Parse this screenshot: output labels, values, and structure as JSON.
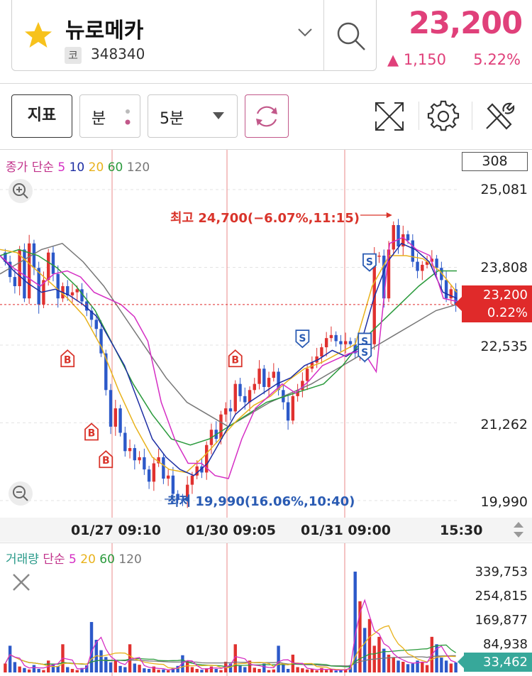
{
  "header": {
    "stock_name": "뉴로메카",
    "code_badge": "코",
    "stock_code": "348340",
    "price": "23,200",
    "change": "▲ 1,150",
    "change_rate": "5.22%"
  },
  "toolbar": {
    "indicator_label": "지표",
    "unit_label": "분",
    "interval_label": "5분"
  },
  "chart_data": {
    "type": "candlestick",
    "legend": {
      "price_type": "종가",
      "ma_type": "단순",
      "ma_periods": [
        "5",
        "10",
        "20",
        "60",
        "120"
      ]
    },
    "ma_colors": [
      "#d52ec4",
      "#1d2ea3",
      "#e8b21c",
      "#2a9a3c",
      "#777777"
    ],
    "y_ticks": [
      "25,081",
      "23,808",
      "22,535",
      "21,262",
      "19,990"
    ],
    "ylim": [
      19990,
      25081
    ],
    "top_badge": "308",
    "current_price": "23,200",
    "current_rate": "0.22%",
    "x_ticks": [
      "01/27 09:10",
      "01/30 09:05",
      "01/31 09:00",
      "15:30"
    ],
    "high_annotation": "최고 24,700(−6.07%,11:15)",
    "low_annotation": "최저 19,990(16.06%,10:40)",
    "signal_labels": {
      "buy": "B",
      "sell": "S"
    },
    "close": [
      23900,
      23650,
      23500,
      24100,
      23300,
      24200,
      23800,
      23200,
      23600,
      24050,
      23700,
      23300,
      23500,
      23350,
      23400,
      23450,
      23250,
      23100,
      22950,
      22800,
      22400,
      21800,
      21200,
      21500,
      21100,
      20800,
      20850,
      20650,
      20700,
      20500,
      20300,
      20600,
      20700,
      20350,
      20400,
      20100,
      20000,
      19990,
      20250,
      20400,
      20550,
      20450,
      20900,
      21150,
      21000,
      21400,
      21500,
      21450,
      21900,
      21700,
      21600,
      21800,
      21900,
      22150,
      21850,
      22000,
      22100,
      21800,
      21600,
      21300,
      21700,
      21800,
      21950,
      22150,
      22250,
      22350,
      22500,
      22650,
      22700,
      22600,
      22550,
      22600,
      22550,
      22400,
      22500,
      22400,
      22550,
      24000,
      24000,
      23300,
      24100,
      24500,
      24150,
      24350,
      24250,
      23900,
      23750,
      23850,
      23900,
      23950,
      23800,
      23600,
      23300,
      23450,
      23200
    ],
    "buy_signals": [
      {
        "x": 13,
        "price": 22300
      },
      {
        "x": 18,
        "price": 21100
      },
      {
        "x": 21,
        "price": 20650
      },
      {
        "x": 48,
        "price": 22300
      }
    ],
    "sell_signals": [
      {
        "x": 62,
        "price": 22650
      },
      {
        "x": 75,
        "price": 22600
      },
      {
        "x": 75,
        "price": 22420
      },
      {
        "x": 76,
        "price": 23900
      }
    ],
    "ma": {
      "5": [
        24000,
        23800,
        23650,
        23500,
        23700,
        23750,
        23650,
        23400,
        23300,
        23200,
        23000,
        22600,
        21600,
        21000,
        20600,
        20600,
        20400,
        20350,
        21000,
        21500,
        21700,
        21900,
        21750,
        21950,
        22200,
        22300,
        22400,
        22450,
        22100,
        24200,
        24300,
        24100,
        24000,
        23300,
        23250
      ],
      "10": [
        24000,
        23750,
        23550,
        23400,
        23450,
        23350,
        23200,
        23000,
        22600,
        22200,
        21600,
        21000,
        20700,
        20500,
        20400,
        20600,
        21000,
        21400,
        21600,
        21750,
        21900,
        22000,
        22200,
        22300,
        22450,
        22350,
        22500,
        23300,
        23900,
        24200,
        24100,
        23900,
        23400,
        23300
      ],
      "20": [
        24100,
        24050,
        23800,
        23550,
        23300,
        23000,
        22500,
        21800,
        21200,
        20700,
        20500,
        20450,
        20700,
        21000,
        21300,
        21550,
        21700,
        21950,
        22150,
        22250,
        22400,
        22550,
        23500,
        24000,
        24000,
        23950,
        23750,
        23400
      ],
      "60": [
        24000,
        24100,
        24000,
        23800,
        23500,
        23100,
        22500,
        21900,
        21400,
        21000,
        20900,
        21000,
        21200,
        21400,
        21600,
        21700,
        21800,
        21900,
        22200,
        22600,
        22900,
        23200,
        23500,
        23750,
        23750
      ],
      "120": [
        23700,
        23900,
        24100,
        24200,
        23900,
        23500,
        23000,
        22500,
        22000,
        21600,
        21400,
        21200,
        21400,
        21600,
        21750,
        21900,
        22100,
        22300,
        22500,
        22700,
        22900,
        23100,
        23200
      ]
    }
  },
  "volume_data": {
    "legend": {
      "label": "거래량",
      "ma_type": "단순",
      "ma_periods": [
        "5",
        "20",
        "60",
        "120"
      ]
    },
    "ma_colors": [
      "#d52ec4",
      "#e8b21c",
      "#2a9a3c",
      "#777777"
    ],
    "y_ticks": [
      "339,753",
      "254,815",
      "169,877",
      "84,938"
    ],
    "ylim": [
      0,
      339753
    ],
    "current_volume": "33,462",
    "values": [
      30000,
      90000,
      35000,
      20000,
      15000,
      10000,
      25000,
      12000,
      8000,
      40000,
      28000,
      22000,
      95000,
      18000,
      12000,
      8000,
      15000,
      24000,
      170000,
      110000,
      75000,
      52000,
      34000,
      40000,
      22000,
      18000,
      95000,
      30000,
      26000,
      14000,
      12000,
      20000,
      9000,
      10000,
      7000,
      16000,
      22000,
      58000,
      40000,
      18000,
      12000,
      9000,
      14000,
      20000,
      12000,
      8000,
      36000,
      30000,
      95000,
      25000,
      18000,
      40000,
      16000,
      12000,
      30000,
      8000,
      10000,
      90000,
      26000,
      12000,
      60000,
      18000,
      14000,
      10000,
      12000,
      7000,
      15000,
      8000,
      10000,
      6000,
      9000,
      11000,
      25000,
      339753,
      240000,
      150000,
      180000,
      90000,
      120000,
      80000,
      60000,
      50000,
      40000,
      36000,
      28000,
      30000,
      40000,
      35000,
      25000,
      120000,
      95000,
      50000,
      40000,
      30000,
      33462
    ]
  }
}
